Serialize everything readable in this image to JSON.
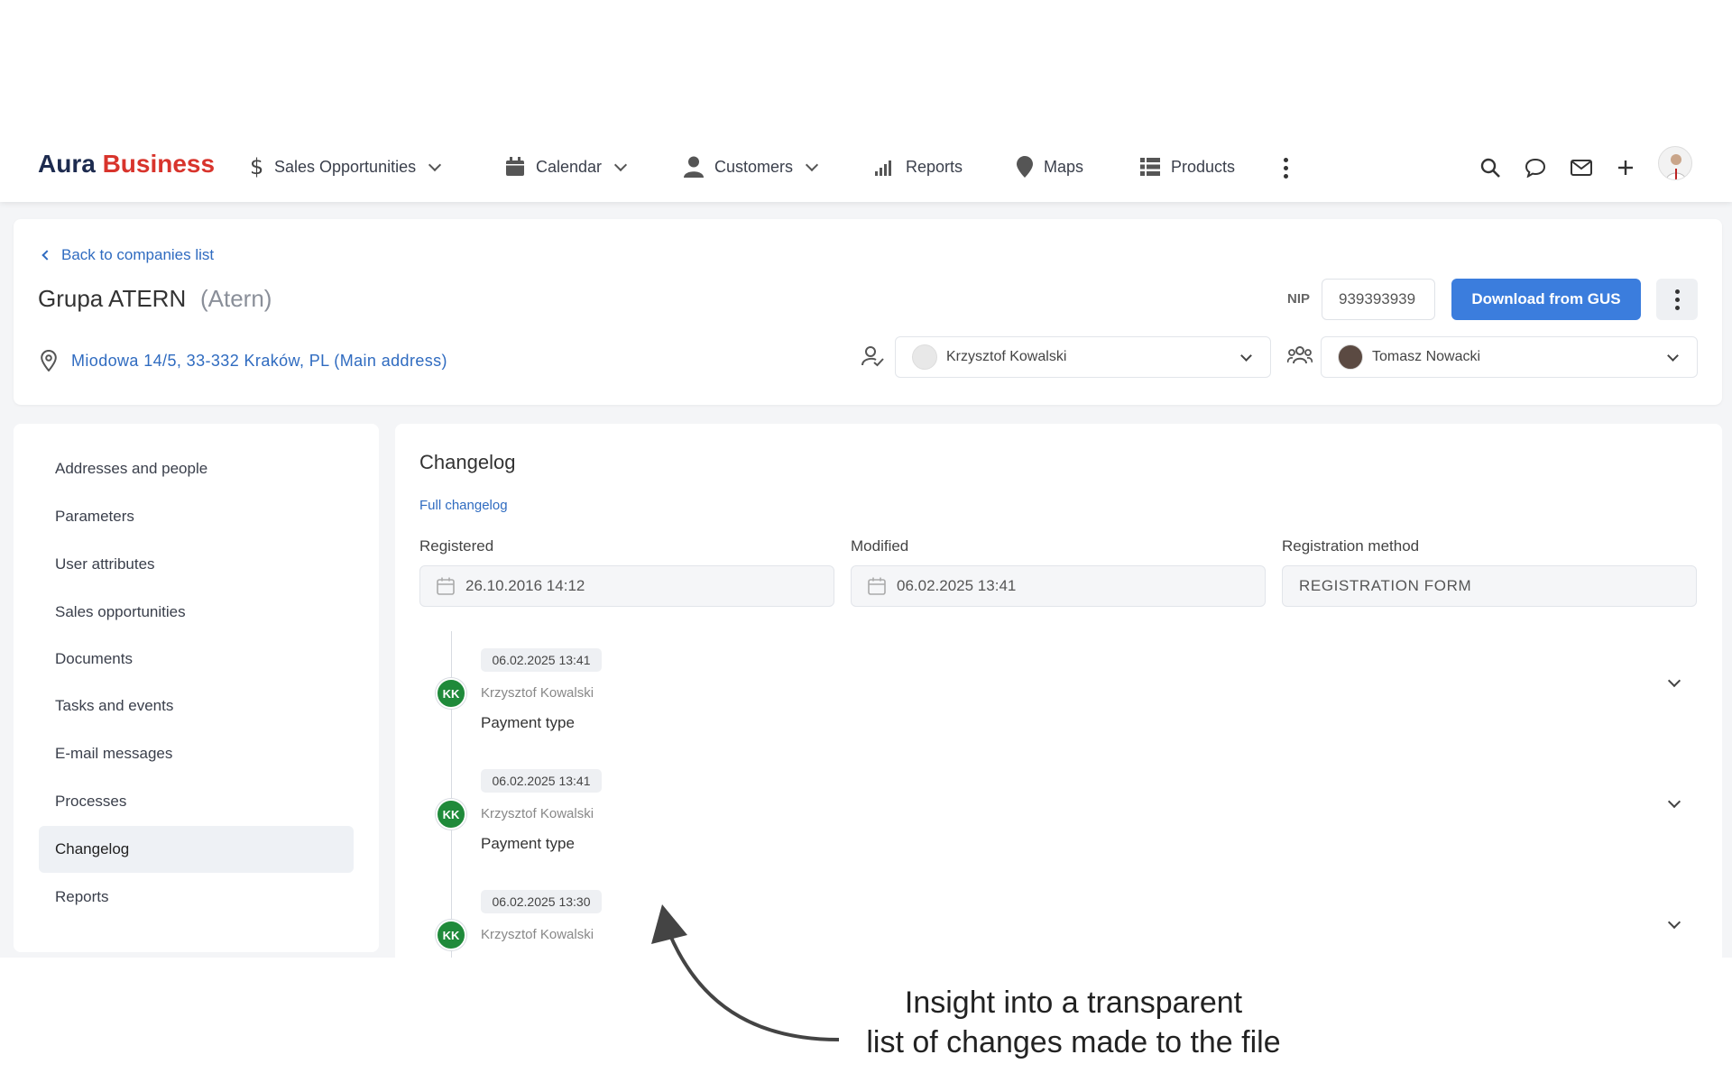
{
  "brand": {
    "part1": "Aura",
    "part2": "Business"
  },
  "nav": {
    "sales": "Sales Opportunities",
    "calendar": "Calendar",
    "customers": "Customers",
    "reports": "Reports",
    "maps": "Maps",
    "products": "Products"
  },
  "header": {
    "back_label": "Back to companies list",
    "company_name": "Grupa ATERN",
    "company_alias": "(Atern)",
    "address": "Miodowa 14/5, 33-332 Kraków, PL (Main address)",
    "nip_label": "NIP",
    "nip_value": "939393939",
    "gus_button": "Download from GUS",
    "owner": "Krzysztof Kowalski",
    "team": "Tomasz Nowacki"
  },
  "sidebar": {
    "items": [
      {
        "label": "Addresses and people"
      },
      {
        "label": "Parameters"
      },
      {
        "label": "User attributes"
      },
      {
        "label": "Sales opportunities"
      },
      {
        "label": "Documents"
      },
      {
        "label": "Tasks and events"
      },
      {
        "label": "E-mail messages"
      },
      {
        "label": "Processes"
      },
      {
        "label": "Changelog"
      },
      {
        "label": "Reports"
      }
    ],
    "active_index": 8
  },
  "changelog": {
    "title": "Changelog",
    "full_link": "Full changelog",
    "registered_label": "Registered",
    "registered_value": "26.10.2016 14:12",
    "modified_label": "Modified",
    "modified_value": "06.02.2025 13:41",
    "method_label": "Registration method",
    "method_value": "REGISTRATION FORM",
    "entries": [
      {
        "date": "06.02.2025 13:41",
        "initials": "KK",
        "author": "Krzysztof Kowalski",
        "title": "Payment type"
      },
      {
        "date": "06.02.2025 13:41",
        "initials": "KK",
        "author": "Krzysztof Kowalski",
        "title": "Payment type"
      },
      {
        "date": "06.02.2025 13:30",
        "initials": "KK",
        "author": "Krzysztof Kowalski",
        "title": ""
      }
    ]
  },
  "caption": {
    "line1": "Insight into a transparent",
    "line2": "list of changes made to the file"
  },
  "colors": {
    "accent": "#3b7ddd",
    "brand_red": "#d8342c",
    "avatar_green": "#1f8a3a"
  }
}
